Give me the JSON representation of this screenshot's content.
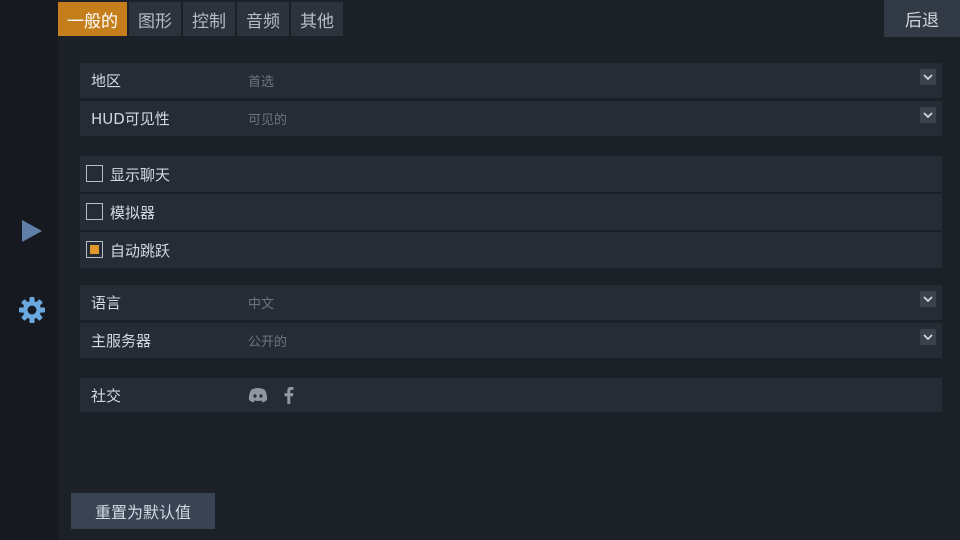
{
  "tabs": [
    {
      "label": "一般的",
      "active": true
    },
    {
      "label": "图形",
      "active": false
    },
    {
      "label": "控制",
      "active": false
    },
    {
      "label": "音频",
      "active": false
    },
    {
      "label": "其他",
      "active": false
    }
  ],
  "back_label": "后退",
  "sidebar": {
    "play_icon": "play-icon",
    "settings_icon": "gear-icon"
  },
  "settings": {
    "region": {
      "label": "地区",
      "value": "首选"
    },
    "hud_visibility": {
      "label": "HUD可见性",
      "value": "可见的"
    },
    "show_chat": {
      "label": "显示聊天",
      "checked": false
    },
    "emulator": {
      "label": "模拟器",
      "checked": false
    },
    "auto_jump": {
      "label": "自动跳跃",
      "checked": true
    },
    "language": {
      "label": "语言",
      "value": "中文"
    },
    "main_server": {
      "label": "主服务器",
      "value": "公开的"
    },
    "social": {
      "label": "社交",
      "icons": [
        "discord-icon",
        "facebook-icon"
      ]
    }
  },
  "reset_label": "重置为默认值",
  "colors": {
    "accent": "#c47f1c",
    "checkbox_fill": "#e0982a",
    "background": "#1c2128",
    "row": "#262c35"
  }
}
